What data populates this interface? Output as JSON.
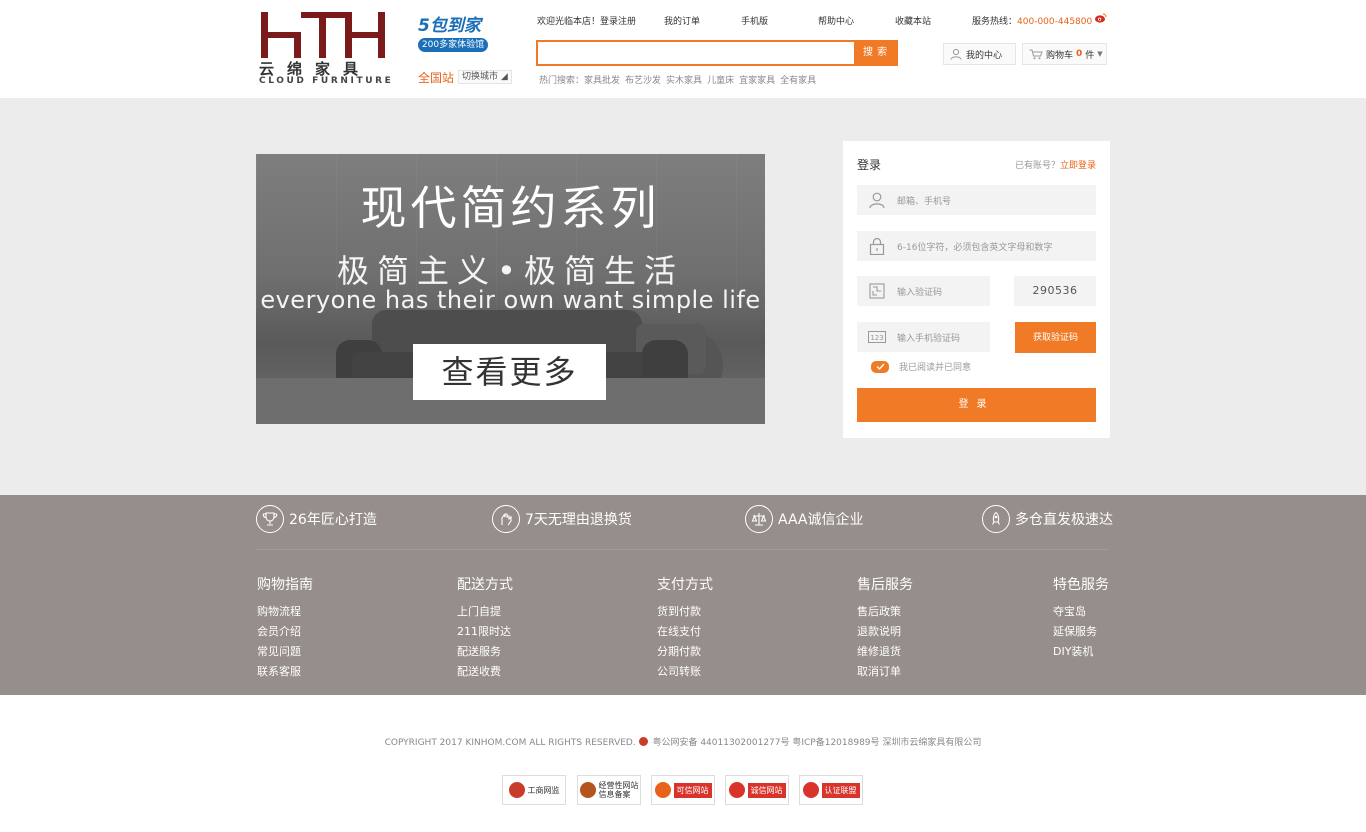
{
  "brand": {
    "logo_cn": "云绵家具",
    "logo_en": "CLOUD FURNITURE",
    "badge_top": "5包到家",
    "badge_bottom": "200多家体验馆",
    "region": "全国站",
    "region_switch": "切换城市"
  },
  "topnav": {
    "welcome": "欢迎光临本店！登录注册",
    "orders": "我的订单",
    "mobile": "手机版",
    "help": "帮助中心",
    "favorite": "收藏本站",
    "hotline_label": "服务热线：",
    "hotline": "400-000-445800"
  },
  "search": {
    "placeholder": "",
    "button": "搜索",
    "hot_label": "热门搜索：",
    "hot": [
      "家具批发",
      "布艺沙发",
      "实木家具",
      "儿童床",
      "宜家家具",
      "全有家具"
    ]
  },
  "account": {
    "my_center": "我的中心",
    "cart_label": "购物车",
    "cart_count": "0",
    "cart_unit": "件"
  },
  "promo": {
    "title": "现代简约系列",
    "subtitle": "极简主义•极简生活",
    "english": "everyone has their own want simple life",
    "button": "查看更多"
  },
  "login": {
    "title": "登录",
    "tip": "已有账号？",
    "tip_link": "立即登录",
    "account_placeholder": "邮箱、手机号",
    "password_placeholder": "6-16位字符，必须包含英文字母和数字",
    "captcha_placeholder": "输入验证码",
    "captcha_code": "290536",
    "sms_placeholder": "输入手机验证码",
    "sms_button": "获取验证码",
    "agree": "我已阅读并已同意",
    "submit": "登录"
  },
  "features": [
    {
      "icon": "trophy-icon",
      "label": "26年匠心打造"
    },
    {
      "icon": "hand-icon",
      "label": "7天无理由退换货"
    },
    {
      "icon": "scale-icon",
      "label": "AAA诚信企业"
    },
    {
      "icon": "rocket-icon",
      "label": "多仓直发极速达"
    }
  ],
  "footer_cols": [
    {
      "title": "购物指南",
      "links": [
        "购物流程",
        "会员介绍",
        "常见问题",
        "联系客服"
      ]
    },
    {
      "title": "配送方式",
      "links": [
        "上门自提",
        "211限时达",
        "配送服务",
        "配送收费"
      ]
    },
    {
      "title": "支付方式",
      "links": [
        "货到付款",
        "在线支付",
        "分期付款",
        "公司转账"
      ]
    },
    {
      "title": "售后服务",
      "links": [
        "售后政策",
        "退款说明",
        "维修退货",
        "取消订单"
      ]
    },
    {
      "title": "特色服务",
      "links": [
        "夺宝岛",
        "延保服务",
        "DIY装机"
      ]
    }
  ],
  "copyright": {
    "text": "COPYRIGHT 2017 KINHOM.COM ALL RIGHTS RESERVED.",
    "police": "粤公网安备 44011302001277号 粤ICP备12018989号 深圳市云绵家具有限公司"
  },
  "certs": [
    "工商网监",
    "经营性网站 信息备案",
    "可信网站",
    "诚信网站",
    "认证联盟"
  ],
  "colors": {
    "accent": "#f07a25",
    "brand_red": "#7a1a1a",
    "footer_bg": "#958e8a",
    "banner_bg": "#ececec"
  }
}
